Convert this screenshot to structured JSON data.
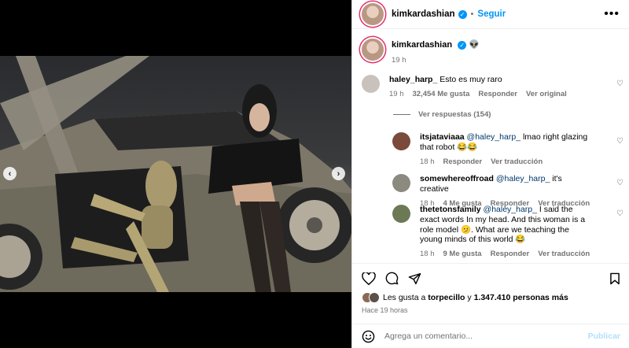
{
  "post": {
    "author": "kimkardashian",
    "follow_label": "Seguir",
    "more_label": "•••",
    "caption_emoji": "👽",
    "caption_time": "19 h"
  },
  "media": {
    "prev_label": "‹",
    "next_label": "›",
    "carousel_dot_count": 14,
    "active_dot_index": 11
  },
  "comments": [
    {
      "user": "haley_harp_",
      "text": "Esto es muy raro",
      "time": "19 h",
      "likes": "32,454 Me gusta",
      "reply": "Responder",
      "translate": "Ver original",
      "avatar_color": "#c9c2bc"
    }
  ],
  "view_replies": "Ver respuestas (154)",
  "replies": [
    {
      "user": "itsjataviaaa",
      "mention": "@haley_harp_",
      "text": "lmao right glazing that robot 😂😂",
      "time": "18 h",
      "likes": "",
      "reply": "Responder",
      "translate": "Ver traducción",
      "avatar_color": "#7a4a3a"
    },
    {
      "user": "somewhereoffroad",
      "mention": "@haley_harp_",
      "text": "it's creative",
      "time": "18 h",
      "likes": "4 Me gusta",
      "reply": "Responder",
      "translate": "Ver traducción",
      "avatar_color": "#8c8a7e"
    },
    {
      "user": "thetetonsfamily",
      "mention": "@haley_harp_",
      "text": "I said the exact words In my head. And this woman is a role model 🫤. What are we teaching the young minds of this world 😂",
      "time": "18 h",
      "likes": "9 Me gusta",
      "reply": "Responder",
      "translate": "Ver traducción",
      "avatar_color": "#6b7a55"
    }
  ],
  "likes": {
    "prefix": "Les gusta a ",
    "user": "torpecillo",
    "middle": " y ",
    "count": "1.347.410 personas más"
  },
  "time_ago": "Hace 19 horas",
  "add_comment": {
    "placeholder": "Agrega un comentario...",
    "publish": "Publicar"
  },
  "colors": {
    "accent": "#0095f6",
    "link": "#00376b",
    "muted": "#737373"
  }
}
